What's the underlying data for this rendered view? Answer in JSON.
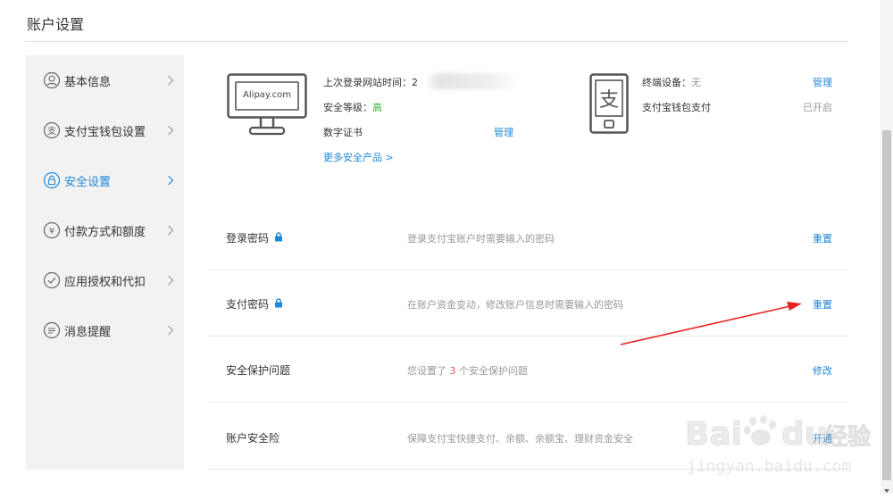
{
  "page": {
    "title": "账户设置"
  },
  "sidebar": {
    "items": [
      {
        "label": "基本信息",
        "icon": "user-icon",
        "active": false
      },
      {
        "label": "支付宝钱包设置",
        "icon": "wallet-icon",
        "active": false
      },
      {
        "label": "安全设置",
        "icon": "lock-icon",
        "active": true
      },
      {
        "label": "付款方式和额度",
        "icon": "yuan-icon",
        "active": false
      },
      {
        "label": "应用授权和代扣",
        "icon": "check-icon",
        "active": false
      },
      {
        "label": "消息提醒",
        "icon": "message-icon",
        "active": false
      }
    ]
  },
  "overview": {
    "monitor_text": "Alipay.com",
    "last_login_label": "上次登录网站时间：2",
    "security_level_label": "安全等级：",
    "security_level_value": "高",
    "digital_cert_label": "数字证书",
    "digital_cert_action": "管理",
    "more_products": "更多安全产品 >",
    "phone_glyph": "支",
    "device_label": "终端设备：",
    "device_value": "无",
    "device_action": "管理",
    "wallet_pay_label": "支付宝钱包支付",
    "wallet_pay_status": "已开启"
  },
  "rows": [
    {
      "name": "登录密码",
      "desc": "登录支付宝账户时需要输入的密码",
      "action": "重置"
    },
    {
      "name": "支付密码",
      "desc": "在账户资金变动，修改账户信息时需要输入的密码",
      "action": "重置"
    },
    {
      "name": "安全保护问题",
      "desc_prefix": "您设置了 ",
      "desc_count": "3",
      "desc_suffix": " 个安全保护问题",
      "action": "修改"
    },
    {
      "name": "账户安全险",
      "desc": "保障支付宝快捷支付、余额、余额宝、理财资金安全",
      "action": "开通"
    }
  ],
  "watermark": {
    "brand": "Baidu经验",
    "url": "jingyan.baidu.com"
  },
  "colors": {
    "accent": "#1f87d8",
    "level_high": "#3cb03c",
    "annotation_arrow": "#e8231f",
    "count_red": "#e55555"
  }
}
